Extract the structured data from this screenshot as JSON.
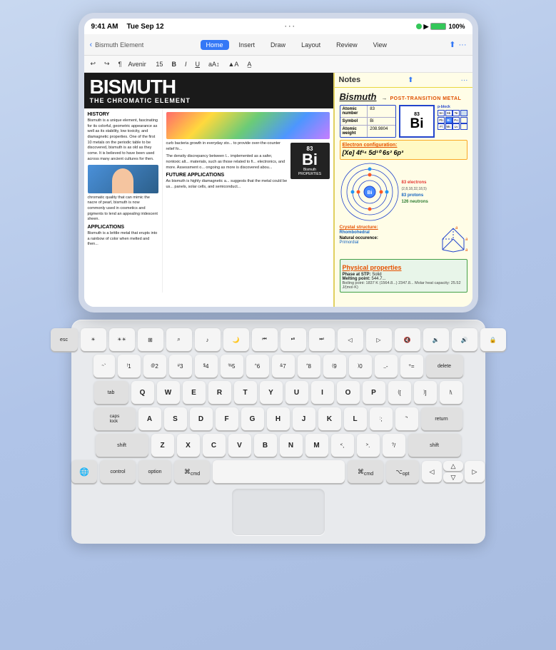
{
  "device": {
    "status_bar": {
      "time": "9:41 AM",
      "date": "Tue Sep 12",
      "wifi": "WiFi",
      "battery": "100%",
      "signal": "●●●"
    },
    "toolbar": {
      "breadcrumb": "Bismuth Element",
      "tabs": [
        "Home",
        "Insert",
        "Draw",
        "Layout",
        "Review",
        "View"
      ],
      "active_tab": "Home",
      "more_icon": "···"
    },
    "format_bar": {
      "undo": "↩",
      "redo": "↪",
      "style": "¶",
      "font": "Avenir",
      "size": "15",
      "bold": "B",
      "italic": "I",
      "underline": "U",
      "text_color": "A",
      "highlight": "A"
    }
  },
  "word_doc": {
    "title": "BISMUTH",
    "subtitle": "THE CHROMATIC ELEMENT",
    "sections": {
      "history": {
        "heading": "HISTORY",
        "text": "Bismuth is a unique element, fascinating for its colorful, geometric appearance as well as its stability, low toxicity, and diamagnetic properties. One of the first 10 metals on the periodic table to be discovered, bismuth is as old as they come. It is believed to have been used across many ancient cultures for then."
      },
      "right_col": {
        "para1": "curb bacteria growth in everyday sto... to provide over-the-counter relief fo...",
        "para2": "The density discrepancy between l... implemented as a safer, nontoxic alt... materials, such as those related to fi... electronics, and more. Assessment o... ongoing as more is discovered abou...",
        "future_heading": "FUTURE APPLICATIONS",
        "future_text": "As bismuth is highly diamagnetic a... suggests that the metal could be us... panels, solar cells, and semiconduct..."
      }
    },
    "element_card": {
      "number": "83",
      "symbol": "Bi",
      "name": "Bismuth",
      "label": "PROPERTIES"
    }
  },
  "notes": {
    "app_name": "Notes",
    "heading": "Bismuth",
    "tag": "Post-Transition Metal",
    "properties": {
      "atomic_number_label": "Atomic number",
      "atomic_number_value": "83",
      "symbol_label": "Symbol",
      "symbol_value": "Bi",
      "atomic_weight_label": "Atomic weight",
      "atomic_weight_value": "208.9804"
    },
    "element_box": {
      "number": "83",
      "symbol": "Bi"
    },
    "pblock_label": "p-block",
    "periodic_neighbors": "Sn Sb Te\nPb Bi Po\nFl Mc Lv",
    "electron_config_heading": "Electron configuration:",
    "electron_config": "[Xe] 4f¹⁴ 5d¹⁰ 6s² 6p³",
    "electrons_label": "83 electrons",
    "electrons_sub": "(2,8,18,32,18,5)",
    "protons_label": "83 protons",
    "neutrons_label": "126 neutrons",
    "crystal_label": "Crystal structure:",
    "crystal_value": "Rhombohedral",
    "occurrence_label": "Natural occurence:",
    "occurrence_value": "Primordial",
    "physical_heading": "Physical properties",
    "phase_label": "Phase at STP:",
    "phase_value": "Solid",
    "melting_label": "Melting point:",
    "melting_value": "544.7...",
    "more_props": "Boiling point: 1837 K (1564.8...) 2347.8... Molar heat capacity: 25.52 J/(mol·K)"
  },
  "keyboard": {
    "rows": [
      {
        "keys": [
          {
            "label": "esc",
            "type": "special"
          },
          {
            "label": "☀",
            "sub": "",
            "type": "fn"
          },
          {
            "label": "☀☀",
            "sub": "",
            "type": "fn"
          },
          {
            "label": "⌘",
            "sub": "",
            "type": "fn"
          },
          {
            "label": "⌕",
            "sub": "",
            "type": "fn"
          },
          {
            "label": "🎤",
            "sub": "",
            "type": "fn"
          },
          {
            "label": "🌙",
            "sub": "",
            "type": "fn"
          },
          {
            "label": "⏮",
            "sub": "",
            "type": "fn"
          },
          {
            "label": "⏯",
            "sub": "",
            "type": "fn"
          },
          {
            "label": "⏭",
            "sub": "",
            "type": "fn"
          },
          {
            "label": "◁",
            "sub": "",
            "type": "fn"
          },
          {
            "label": "▷",
            "sub": "",
            "type": "fn"
          },
          {
            "label": "🔇",
            "sub": "",
            "type": "fn"
          },
          {
            "label": "🔉",
            "sub": "",
            "type": "fn"
          },
          {
            "label": "🔊",
            "sub": "",
            "type": "fn"
          },
          {
            "label": "🔒",
            "sub": "",
            "type": "fn"
          }
        ]
      },
      {
        "keys": [
          {
            "label": "~\n`",
            "type": "normal"
          },
          {
            "label": "!\n1",
            "type": "normal"
          },
          {
            "label": "@\n2",
            "type": "normal"
          },
          {
            "label": "#\n3",
            "type": "normal"
          },
          {
            "label": "$\n4",
            "type": "normal"
          },
          {
            "label": "%\n5",
            "type": "normal"
          },
          {
            "label": "^\n6",
            "type": "normal"
          },
          {
            "label": "&\n7",
            "type": "normal"
          },
          {
            "label": "*\n8",
            "type": "normal"
          },
          {
            "label": "(\n9",
            "type": "normal"
          },
          {
            "label": ")\n0",
            "type": "normal"
          },
          {
            "label": "_\n-",
            "type": "normal"
          },
          {
            "label": "+\n=",
            "type": "normal"
          },
          {
            "label": "delete",
            "type": "special wide"
          }
        ]
      },
      {
        "keys": [
          {
            "label": "tab",
            "type": "special wide"
          },
          {
            "label": "Q",
            "type": "normal"
          },
          {
            "label": "W",
            "type": "normal"
          },
          {
            "label": "E",
            "type": "normal"
          },
          {
            "label": "R",
            "type": "normal"
          },
          {
            "label": "T",
            "type": "normal"
          },
          {
            "label": "Y",
            "type": "normal"
          },
          {
            "label": "U",
            "type": "normal"
          },
          {
            "label": "I",
            "type": "normal"
          },
          {
            "label": "O",
            "type": "normal"
          },
          {
            "label": "P",
            "type": "normal"
          },
          {
            "label": "{\n[",
            "type": "normal"
          },
          {
            "label": "}\n]",
            "type": "normal"
          },
          {
            "label": "|\n\\",
            "type": "normal"
          }
        ]
      },
      {
        "keys": [
          {
            "label": "caps\nlock",
            "type": "special wider"
          },
          {
            "label": "A",
            "type": "normal"
          },
          {
            "label": "S",
            "type": "normal"
          },
          {
            "label": "D",
            "type": "normal"
          },
          {
            "label": "F",
            "type": "normal"
          },
          {
            "label": "G",
            "type": "normal"
          },
          {
            "label": "H",
            "type": "normal"
          },
          {
            "label": "J",
            "type": "normal"
          },
          {
            "label": "K",
            "type": "normal"
          },
          {
            "label": "L",
            "type": "normal"
          },
          {
            "label": ":\n;",
            "type": "normal"
          },
          {
            "label": "\"\n'",
            "type": "normal"
          },
          {
            "label": "return",
            "type": "special wider"
          }
        ]
      },
      {
        "keys": [
          {
            "label": "shift",
            "type": "special widest"
          },
          {
            "label": "Z",
            "type": "normal"
          },
          {
            "label": "X",
            "type": "normal"
          },
          {
            "label": "C",
            "type": "normal"
          },
          {
            "label": "V",
            "type": "normal"
          },
          {
            "label": "B",
            "type": "normal"
          },
          {
            "label": "N",
            "type": "normal"
          },
          {
            "label": "M",
            "type": "normal"
          },
          {
            "label": "<\n,",
            "type": "normal"
          },
          {
            "label": ">\n.",
            "type": "normal"
          },
          {
            "label": "?\n/",
            "type": "normal"
          },
          {
            "label": "shift",
            "type": "special widest"
          }
        ]
      },
      {
        "keys": [
          {
            "label": "🌐",
            "type": "special fn"
          },
          {
            "label": "control",
            "type": "special wider"
          },
          {
            "label": "option",
            "type": "special wider"
          },
          {
            "label": "⌘\ncmd",
            "type": "special wider"
          },
          {
            "label": "",
            "type": "space"
          },
          {
            "label": "⌘\ncmd",
            "type": "special wider"
          },
          {
            "label": "⌥\nopt",
            "type": "special wider"
          },
          {
            "label": "◁\n▷",
            "type": "special arrows"
          }
        ]
      }
    ]
  }
}
